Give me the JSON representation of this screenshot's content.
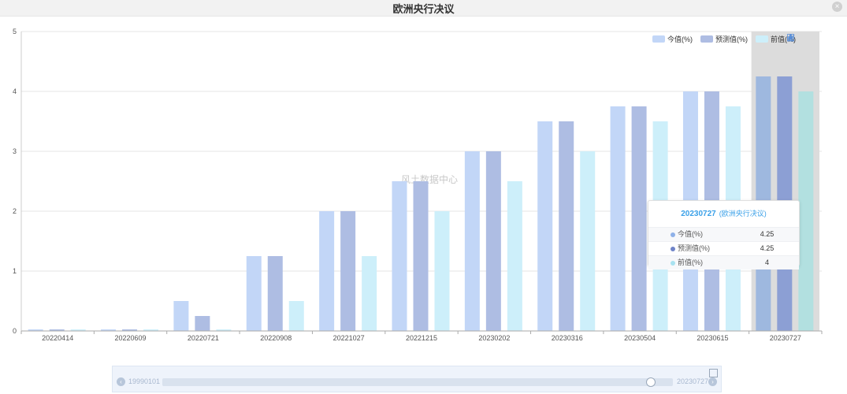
{
  "window": {
    "title": "欧洲央行决议"
  },
  "legend": [
    "今值(%)",
    "预测值(%)",
    "前值(%)"
  ],
  "toolbox": [
    "line-chart-icon",
    "bar-chart-icon",
    "download-icon",
    "data-view-icon"
  ],
  "watermark": "风土数据中心",
  "tooltip": {
    "date": "20230727",
    "event": "(欧洲央行决议)",
    "rows": [
      {
        "label": "今值(%)",
        "value": "4.25"
      },
      {
        "label": "预测值(%)",
        "value": "4.25"
      },
      {
        "label": "前值(%)",
        "value": "4"
      }
    ]
  },
  "zoom": {
    "start": "19990101",
    "end": "20230727"
  },
  "colors": {
    "actual": "#c2d6f7",
    "forecast": "#aebde3",
    "previous": "#cdeffa",
    "actual_hl": "#9eb8df",
    "forecast_hl": "#8c9fd4",
    "previous_hl": "#b2e0e0"
  },
  "chart_data": {
    "type": "bar",
    "categories": [
      "20220414",
      "20220609",
      "20220721",
      "20220908",
      "20221027",
      "20221215",
      "20230202",
      "20230316",
      "20230504",
      "20230615",
      "20230727"
    ],
    "series": [
      {
        "name": "今值(%)",
        "values": [
          0,
          0,
          0.5,
          1.25,
          2,
          2.5,
          3,
          3.5,
          3.75,
          4,
          4.25
        ]
      },
      {
        "name": "预测值(%)",
        "values": [
          0,
          0,
          0.25,
          1.25,
          2,
          2.5,
          3,
          3.5,
          3.75,
          4,
          4.25
        ]
      },
      {
        "name": "前值(%)",
        "values": [
          0,
          0,
          0,
          0.5,
          1.25,
          2,
          2.5,
          3,
          3.5,
          3.75,
          4
        ]
      }
    ],
    "ylim": [
      0,
      5
    ],
    "yticks": [
      0,
      1,
      2,
      3,
      4,
      5
    ],
    "grid": true,
    "legend_position": "top-right",
    "highlighted_category": "20230727"
  }
}
